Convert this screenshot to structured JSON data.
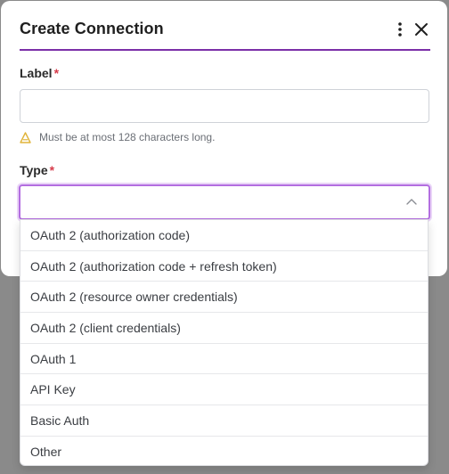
{
  "dialog": {
    "title": "Create Connection",
    "menu_icon": "kebab-icon",
    "close_icon": "close-icon"
  },
  "label_field": {
    "label": "Label",
    "required_mark": "*",
    "value": "",
    "hint_icon": "warning-triangle-icon",
    "hint": "Must be at most 128 characters long."
  },
  "type_field": {
    "label": "Type",
    "required_mark": "*",
    "value": "",
    "chevron_icon": "chevron-up-icon",
    "options": [
      "OAuth 2 (authorization code)",
      "OAuth 2 (authorization code + refresh token)",
      "OAuth 2 (resource owner credentials)",
      "OAuth 2 (client credentials)",
      "OAuth 1",
      "API Key",
      "Basic Auth",
      "Other"
    ]
  },
  "colors": {
    "accent": "#7b2fa8",
    "focus_border": "#b36ee0",
    "required": "#d63b4a",
    "hint_icon": "#e0b43a"
  }
}
